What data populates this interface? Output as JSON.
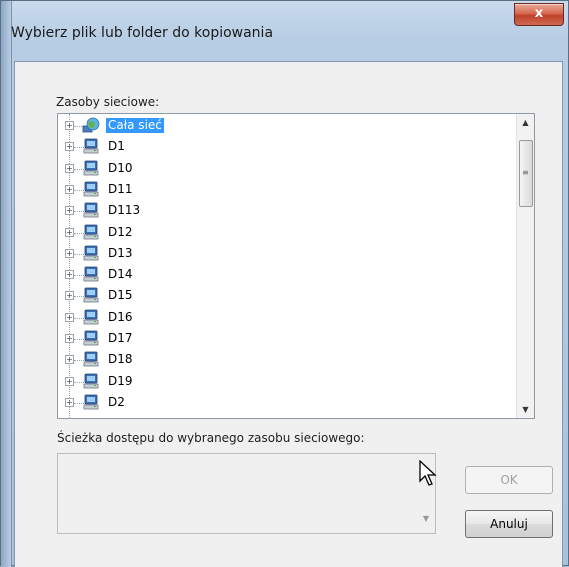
{
  "window": {
    "title": "Wybierz plik lub folder do kopiowania",
    "close_label": "x"
  },
  "tree": {
    "label": "Zasoby sieciowe:",
    "items": [
      {
        "label": "Cała sieć",
        "icon": "network-globe-icon",
        "selected": true
      },
      {
        "label": "D1",
        "icon": "computer-icon"
      },
      {
        "label": "D10",
        "icon": "computer-icon"
      },
      {
        "label": "D11",
        "icon": "computer-icon"
      },
      {
        "label": "D113",
        "icon": "computer-icon"
      },
      {
        "label": "D12",
        "icon": "computer-icon"
      },
      {
        "label": "D13",
        "icon": "computer-icon"
      },
      {
        "label": "D14",
        "icon": "computer-icon"
      },
      {
        "label": "D15",
        "icon": "computer-icon"
      },
      {
        "label": "D16",
        "icon": "computer-icon"
      },
      {
        "label": "D17",
        "icon": "computer-icon"
      },
      {
        "label": "D18",
        "icon": "computer-icon"
      },
      {
        "label": "D19",
        "icon": "computer-icon"
      },
      {
        "label": "D2",
        "icon": "computer-icon"
      }
    ]
  },
  "path": {
    "label": "Ścieżka dostępu do wybranego zasobu sieciowego:",
    "value": ""
  },
  "buttons": {
    "ok": "OK",
    "cancel": "Anuluj"
  },
  "colors": {
    "selection": "#3399ff",
    "close_button": "#c9503a"
  }
}
